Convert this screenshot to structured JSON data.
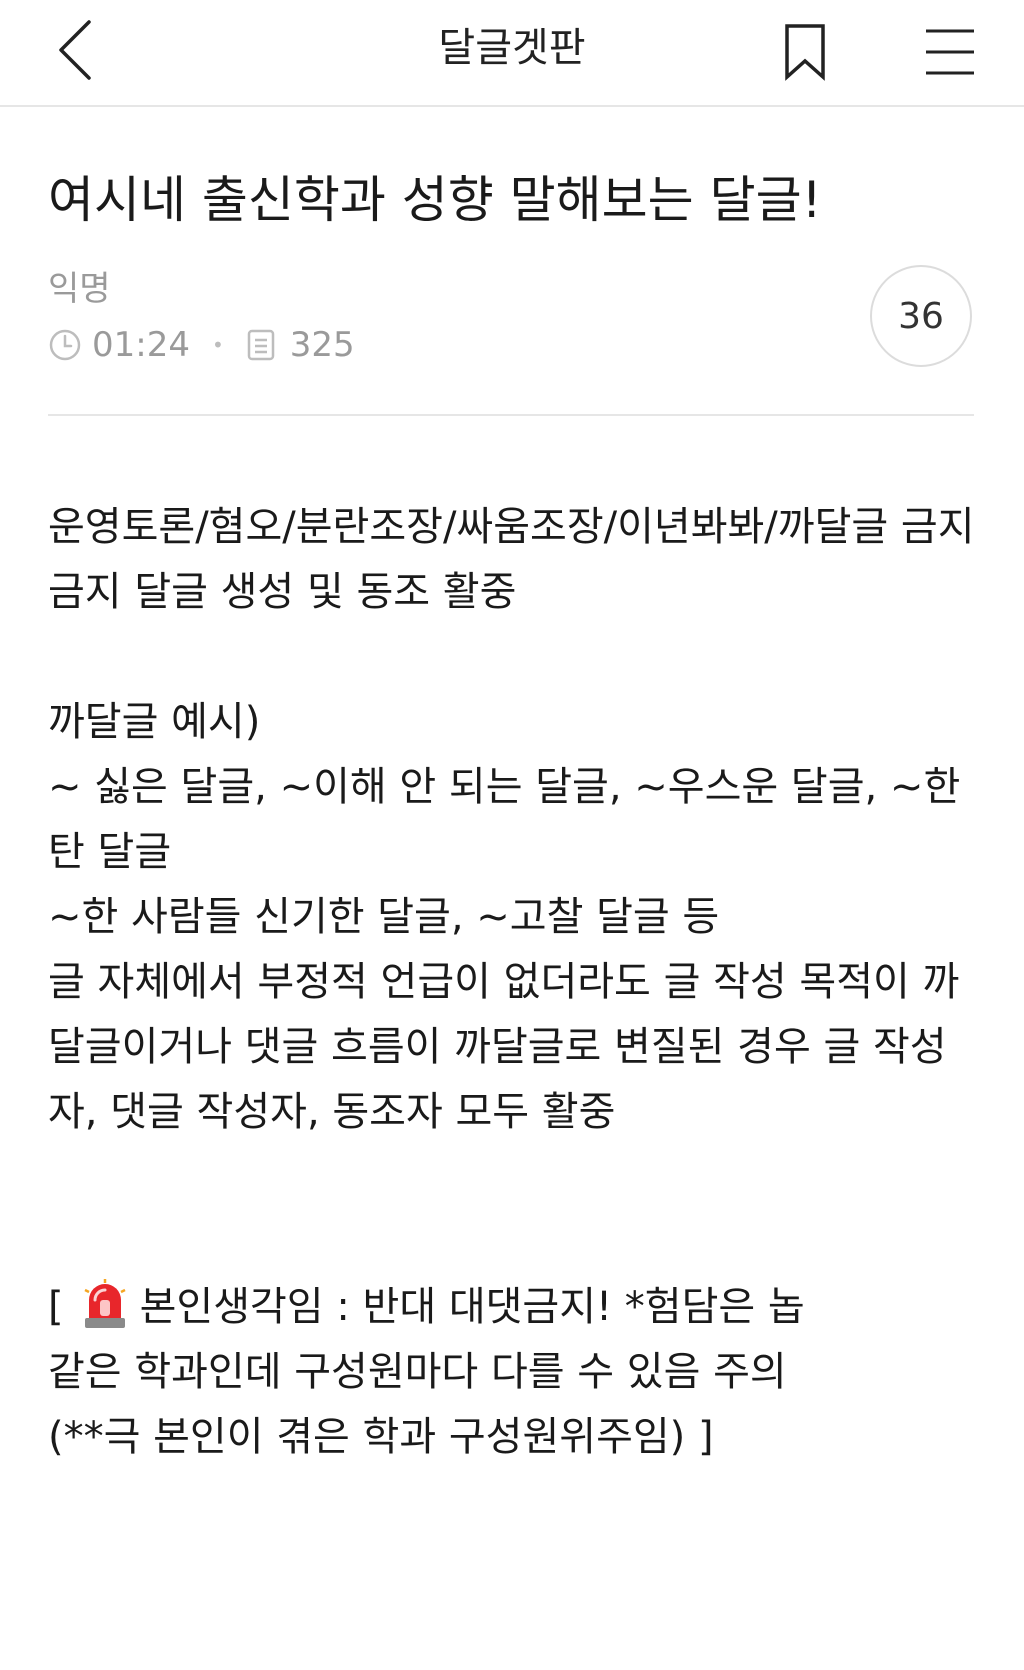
{
  "header": {
    "board_title": "달글겟판"
  },
  "post": {
    "title": "여시네 출신학과 성향 말해보는 달글!",
    "author": "익명",
    "time": "01:24",
    "views": "325",
    "comment_count": "36",
    "body": {
      "line1": "운영토론/혐오/분란조장/싸움조장/이년봐봐/까달글 금지",
      "line2": "금지 달글 생성 및 동조 활중",
      "line3": "까달글 예시)",
      "line4": "~ 싫은 달글, ~이해 안 되는 달글, ~우스운 달글, ~한탄 달글",
      "line5": "~한 사람들 신기한 달글, ~고찰 달글 등",
      "line6": "글 자체에서 부정적 언급이 없더라도 글 작성 목적이 까달글이거나 댓글 흐름이 까달글로 변질된 경우 글 작성자, 댓글 작성자, 동조자 모두 활중",
      "notice_open": "[",
      "notice_text": "본인생각임 : 반대 대댓금지! *험담은 놉",
      "notice_line2": "같은 학과인데 구성원마다 다를 수 있음 주의",
      "notice_line3": "(**극 본인이 겪은 학과 구성원위주임) ]"
    }
  },
  "icons": {
    "back": "chevron-left-icon",
    "bookmark": "bookmark-icon",
    "menu": "hamburger-menu-icon",
    "clock": "clock-icon",
    "views": "document-icon",
    "siren": "siren-emoji-icon"
  },
  "colors": {
    "text": "#1a1a1a",
    "meta": "#9a9a9a",
    "divider": "#e6e6e6",
    "siren_red": "#e8262b"
  }
}
